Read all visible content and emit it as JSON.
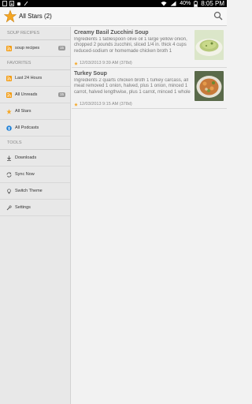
{
  "status_bar": {
    "battery_pct": "40%",
    "time": "8:05 PM"
  },
  "action_bar": {
    "title": "All Stars (2)"
  },
  "sidebar": {
    "sections": [
      {
        "title": "SOUP RECIPES",
        "items": [
          {
            "label": "soup recipes",
            "badge": "15",
            "icon": "rss-icon"
          }
        ]
      },
      {
        "title": "FAVORITES",
        "items": [
          {
            "label": "Last 24 Hours",
            "icon": "clock-icon"
          },
          {
            "label": "All Unreads",
            "badge": "15",
            "icon": "rss-icon"
          },
          {
            "label": "All Stars",
            "icon": "star-icon"
          },
          {
            "label": "All Podcasts",
            "icon": "podcast-icon"
          }
        ]
      },
      {
        "title": "TOOLS",
        "items": [
          {
            "label": "Downloads",
            "icon": "download-icon"
          },
          {
            "label": "Sync Now",
            "icon": "sync-icon"
          },
          {
            "label": "Switch Theme",
            "icon": "theme-icon"
          },
          {
            "label": "Settings",
            "icon": "settings-icon"
          }
        ]
      }
    ]
  },
  "articles": [
    {
      "title": "Creamy Basil Zucchini Soup",
      "snippet": "Ingredients 1 tablespoon  olive oil  1  large yellow onion, chopped  2 pounds  zucchini, sliced 1/4 in. thick 4 cups  reduced-sodium or homemade chicken broth 1",
      "meta": "12/03/2013 9:39 AM (378d)"
    },
    {
      "title": "Turkey Soup",
      "snippet": "Ingredients 2 quarts chicken broth 1 turkey carcass, all meat removed 1 onion, halved, plus 1 onion, minced 1 carrot, halved lengthwise, plus 1 carrot, minced 1 whole",
      "meta": "12/03/2013 9:15 AM (378d)"
    }
  ],
  "colors": {
    "accent_star": "#f5a623",
    "rss_orange": "#f39c12",
    "podcast_blue": "#2a86d8"
  }
}
